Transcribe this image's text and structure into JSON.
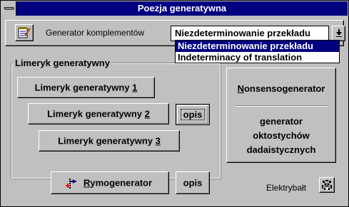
{
  "window": {
    "title": "Poezja generatywna"
  },
  "generator": {
    "label": "Generator komplementów",
    "selected_value": "Niezdeterminowanie przekładu",
    "options": [
      "Niezdeterminowanie przekładu",
      "Indeterminacy of translation"
    ]
  },
  "limerick_group": {
    "label": "Limeryk generatywny",
    "buttons": [
      {
        "label": "Limeryk generatywny ",
        "accel": "1"
      },
      {
        "label": "Limeryk generatywny ",
        "accel": "2"
      },
      {
        "label": "Limeryk generatywny ",
        "accel": "3"
      }
    ],
    "opis_label": "opis"
  },
  "nonsense": {
    "accel": "N",
    "label_rest": "onsensogenerator",
    "subtitle_lines": [
      "generator",
      "oktostychów",
      "dadaistycznych"
    ]
  },
  "rhyme": {
    "accel": "R",
    "label_rest": "ymogenerator",
    "opis_label": "opis"
  },
  "elektrybalt": {
    "label": "Elektrybałt"
  },
  "colors": {
    "title_bar": "#000080",
    "face": "#c0c0c0",
    "selection": "#000080"
  }
}
